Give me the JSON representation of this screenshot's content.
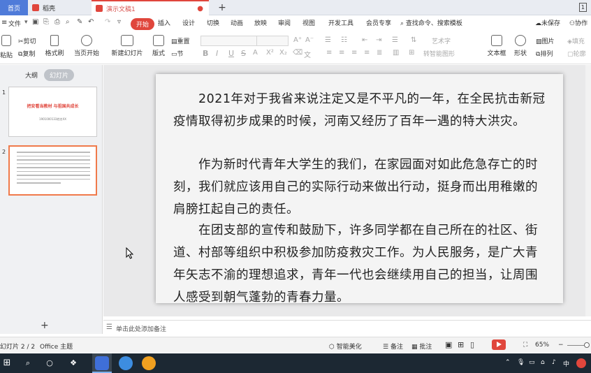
{
  "tabs": {
    "home": "首页",
    "doc1": "稻壳",
    "active": "演示文稿1",
    "plus": "+",
    "win_count": "1"
  },
  "menu": {
    "file": "文件",
    "items": [
      "开始",
      "插入",
      "设计",
      "切换",
      "动画",
      "放映",
      "审阅",
      "视图",
      "开发工具",
      "会员专享"
    ],
    "search": "查找命令、搜索模板",
    "unsaved": "未保存",
    "collab": "协作"
  },
  "ribbon": {
    "paste": "粘贴",
    "cut": "剪切",
    "copy": "复制",
    "format_painter": "格式刷",
    "from_current": "当页开始",
    "new_slide": "新建幻灯片",
    "layout": "版式",
    "reset": "重置",
    "section": "节",
    "text_box": "文本框",
    "shape": "形状",
    "picture": "图片",
    "arrange": "排列",
    "fill": "填充",
    "outline": "轮廓",
    "art_text": "艺术字",
    "convert_graphic": "转智能图形",
    "bold": "B",
    "italic": "I",
    "underline": "U",
    "strike": "S"
  },
  "left_panel": {
    "outline_tab": "大纲",
    "slides_tab": "幻灯片",
    "slide1_num": "1",
    "slide2_num": "2",
    "slide1_title": "把安看当教材 与祖国共成长",
    "slide1_sub": "1901000133姓名XX",
    "add": "+"
  },
  "slide": {
    "p1": "　　2021年对于我省来说注定又是不平凡的一年，在全民抗击新冠疫情取得初步成果的时候，河南又经历了百年一遇的特大洪灾。",
    "p2": "　　作为新时代青年大学生的我们，在家园面对如此危急存亡的时刻，我们就应该用自己的实际行动来做出行动，挺身而出用稚嫩的肩膀扛起自己的责任。",
    "p3": "　　在团支部的宣传和鼓励下，许多同学都在自己所在的社区、街道、村部等组织中积极参加防疫救灾工作。为人民服务，是广大青年矢志不渝的理想追求，青年一代也会继续用自己的担当，让周围人感受到朝气蓬勃的青春力量。"
  },
  "notes": {
    "placeholder": "单击此处添加备注"
  },
  "status": {
    "slide_count": "幻灯片 2 / 2",
    "theme": "Office 主题",
    "beautify": "智能美化",
    "notes": "备注",
    "comments": "批注",
    "zoom": "65%",
    "minus": "−"
  },
  "taskbar": {
    "lang": "中"
  },
  "colors": {
    "accent": "#e0463c",
    "home_tab": "#4f7bd9",
    "taskbar": "#1c2833"
  }
}
